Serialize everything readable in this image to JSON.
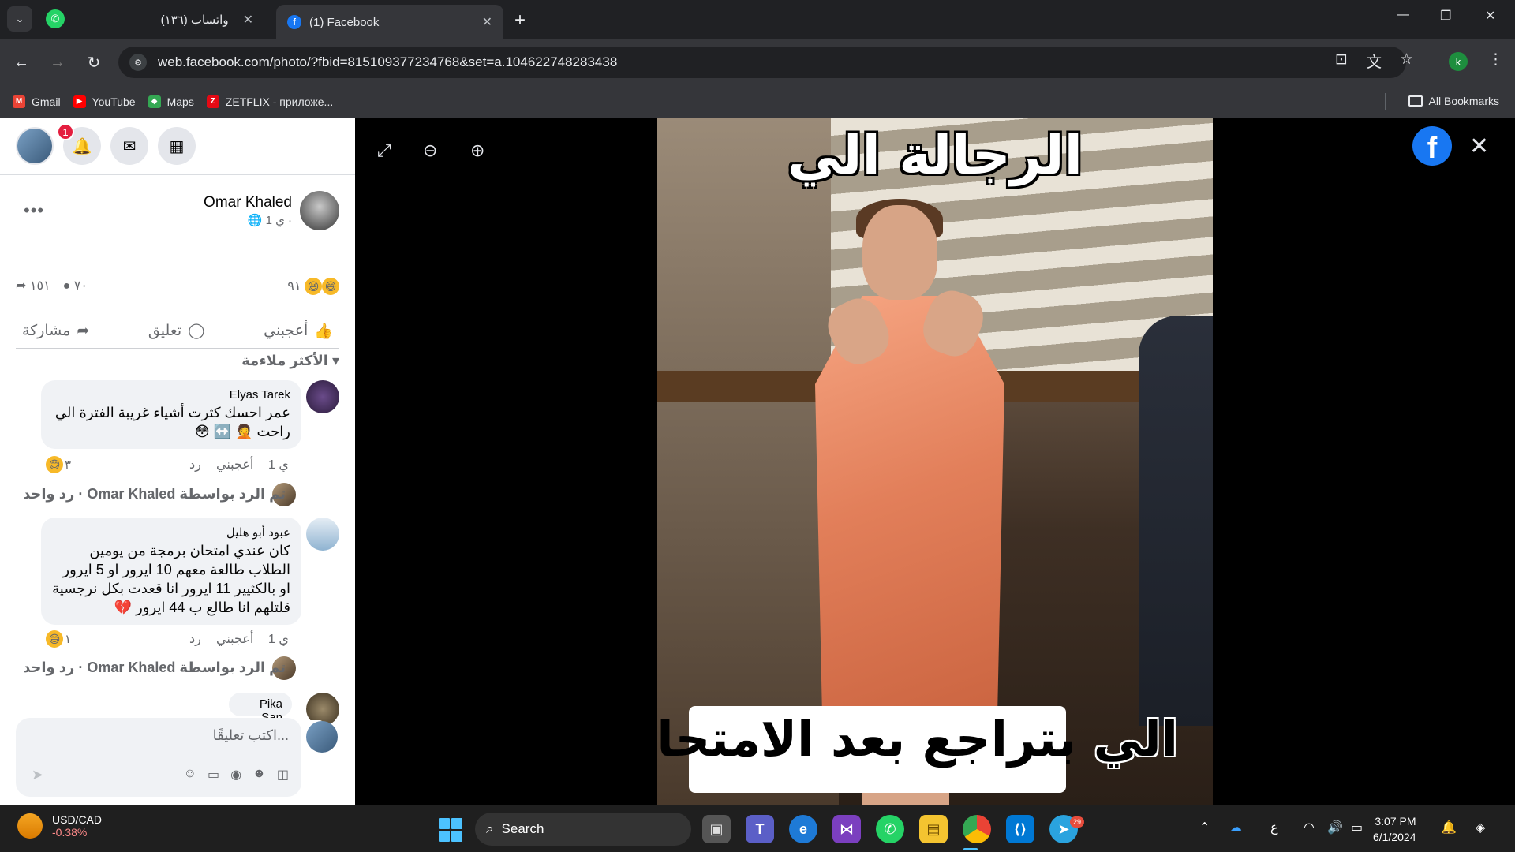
{
  "browser": {
    "tabs": [
      {
        "title": "(١٣٦) واتساب",
        "favicon": "whatsapp-icon"
      },
      {
        "title": "(1) Facebook",
        "favicon": "facebook-icon"
      }
    ],
    "url": "web.facebook.com/photo/?fbid=815109377234768&set=a.104622748283438",
    "profile_initial": "k",
    "bookmarks": [
      {
        "label": "Gmail",
        "icon": "gmail-icon",
        "color": "#ea4335",
        "glyph": "M"
      },
      {
        "label": "YouTube",
        "icon": "youtube-icon",
        "color": "#ff0000",
        "glyph": "▶"
      },
      {
        "label": "Maps",
        "icon": "maps-icon",
        "color": "#34a853",
        "glyph": "◆"
      },
      {
        "label": "ZETFLIX - приложе...",
        "icon": "zetflix-icon",
        "color": "#e50914",
        "glyph": "Z"
      }
    ],
    "all_bookmarks": "All Bookmarks"
  },
  "sidebar": {
    "notification_count": "1",
    "post": {
      "author": "Omar Khaled",
      "meta": "1 ي ·",
      "reaction_count": "٩١",
      "comment_count": "٧٠",
      "share_count": "١٥١"
    },
    "actions": {
      "like": "أعجبني",
      "comment": "تعليق",
      "share": "مشاركة"
    },
    "sort_label": "الأكثر ملاءمة",
    "comments": [
      {
        "name": "Elyas Tarek",
        "text": "عمر احسك كثرت أشياء غريبة الفترة الي راحت 🤦 ↔️ 😳",
        "time": "1 ي",
        "like": "أعجبني",
        "reply": "رد",
        "reactions": "٣",
        "reply_summary": "تم الرد بواسطة Omar Khaled · رد واحد"
      },
      {
        "name": "عبود أبو هليل",
        "text": "كان عندي امتحان برمجة من يومين الطلاب طالعة معهم 10 ايرور او 5 ايرور او بالكثيير 11 ايرور انا قعدت بكل نرجسية قلتلهم انا طالع ب 44 ايرور 💔",
        "time": "1 ي",
        "like": "أعجبني",
        "reply": "رد",
        "reactions": "١",
        "reply_summary": "تم الرد بواسطة Omar Khaled · رد واحد"
      },
      {
        "name": "Pika San"
      }
    ],
    "composer_placeholder": "اكتب تعليقًا..."
  },
  "photo": {
    "caption_top": "الرجالة الي",
    "caption_bottom_1": "الي",
    "caption_bottom_2": "بتراجع بعد الامتحان"
  },
  "taskbar": {
    "ticker_symbol": "USD/CAD",
    "ticker_change": "-0.38%",
    "search": "Search",
    "telegram_badge": "29",
    "lang": "ع",
    "time": "3:07 PM",
    "date": "6/1/2024"
  }
}
